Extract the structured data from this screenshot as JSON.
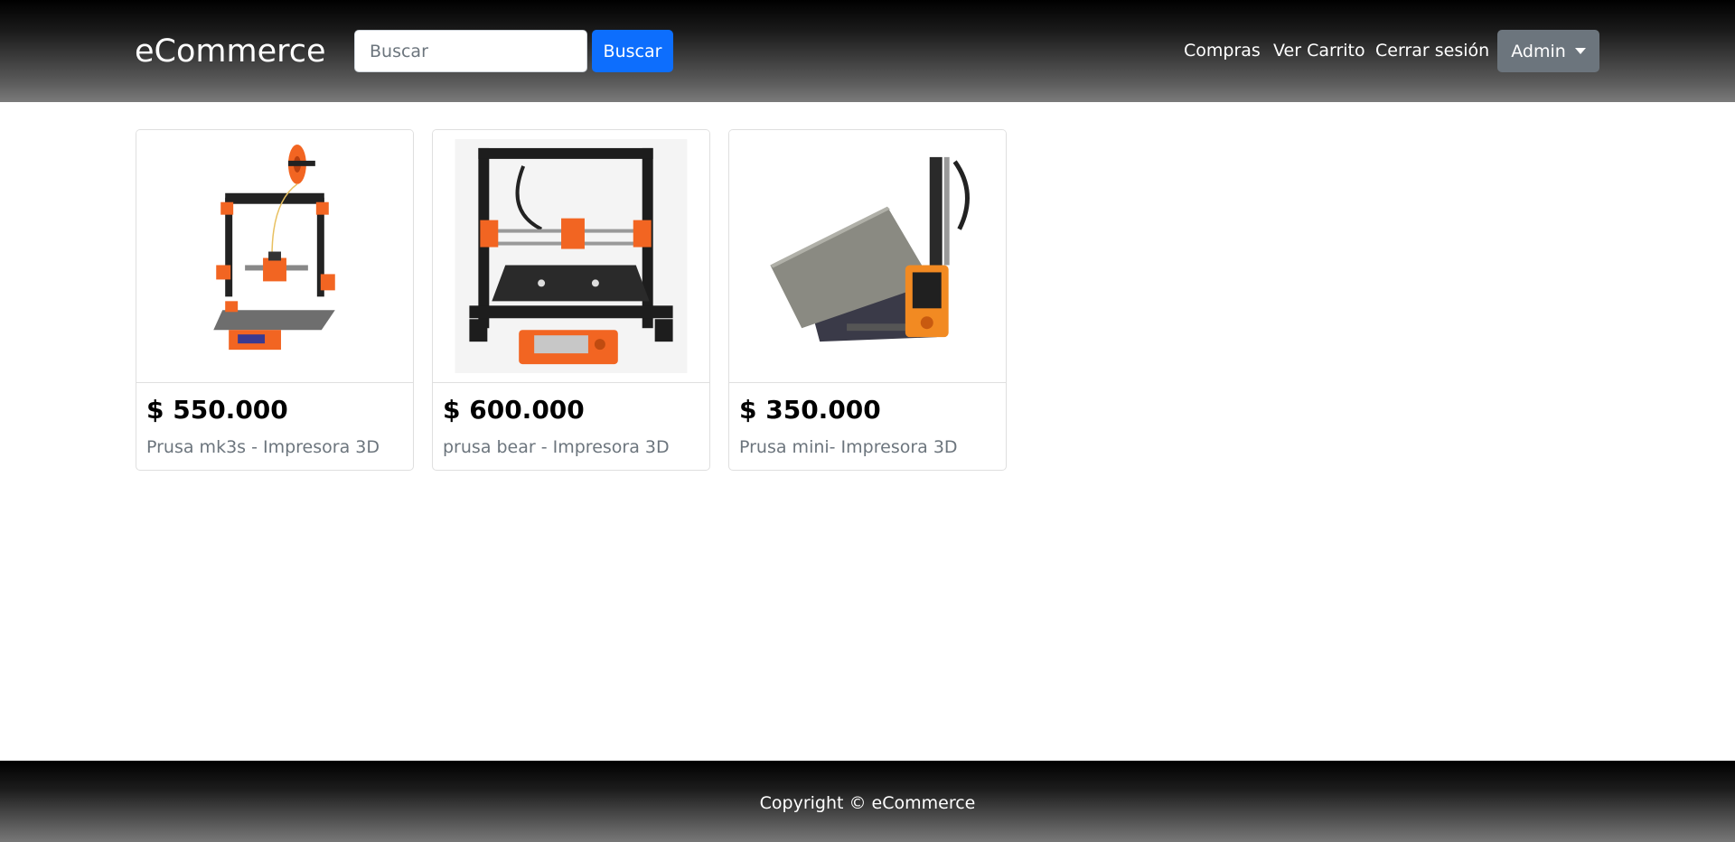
{
  "navbar": {
    "brand": "eCommerce",
    "search": {
      "placeholder": "Buscar",
      "value": ""
    },
    "search_button": "Buscar",
    "links": [
      "Compras",
      "Ver Carrito",
      "Cerrar sesión"
    ],
    "admin_dropdown": "Admin"
  },
  "products": [
    {
      "price": "$ 550.000",
      "title": "Prusa mk3s - Impresora 3D",
      "image": "3d-printer-mk3s"
    },
    {
      "price": "$ 600.000",
      "title": "prusa bear - Impresora 3D",
      "image": "3d-printer-bear"
    },
    {
      "price": "$ 350.000",
      "title": "Prusa mini- Impresora 3D",
      "image": "3d-printer-mini"
    }
  ],
  "footer": {
    "text": "Copyright © eCommerce"
  },
  "colors": {
    "primary": "#0d6efd",
    "secondary": "#6c757d",
    "accent_orange": "#f26522"
  }
}
